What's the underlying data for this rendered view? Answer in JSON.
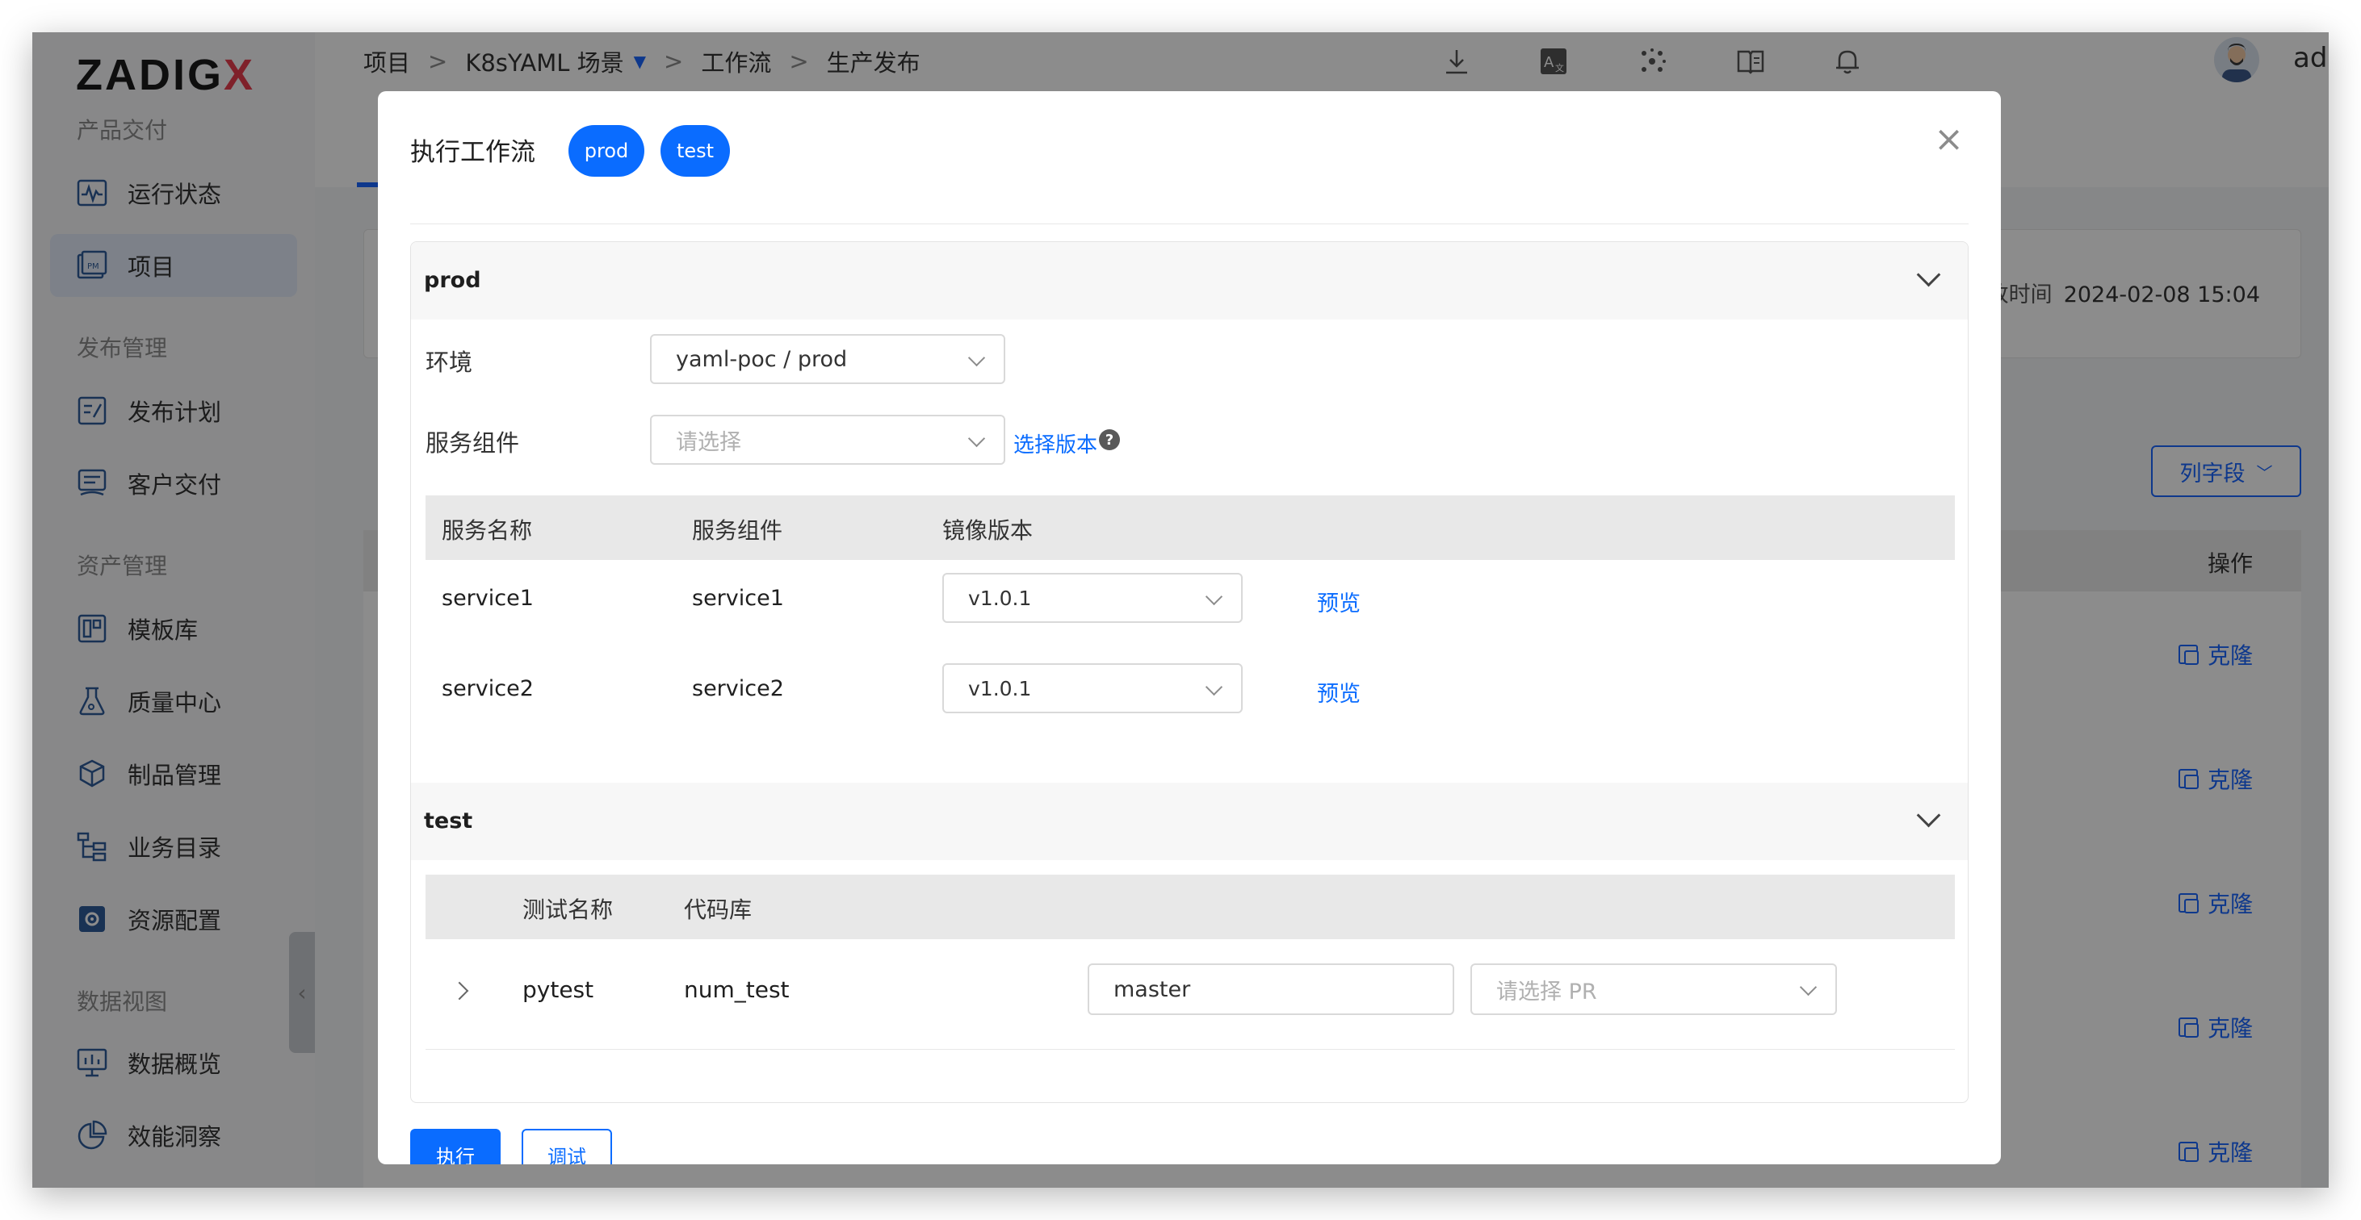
{
  "brand": {
    "logo_main": "ZADIG",
    "logo_x": "X",
    "accent": "#0a6cff",
    "logo_accent": "#e73c4e"
  },
  "sidebar": {
    "groups": [
      "产品交付",
      "发布管理",
      "资产管理",
      "数据视图"
    ],
    "items": [
      {
        "label": "运行状态",
        "icon": "pulse-chart-icon"
      },
      {
        "label": "项目",
        "icon": "project-pm-icon",
        "active": true
      },
      {
        "label": "发布计划",
        "icon": "release-plan-icon"
      },
      {
        "label": "客户交付",
        "icon": "customer-delivery-icon"
      },
      {
        "label": "模板库",
        "icon": "template-icon"
      },
      {
        "label": "质量中心",
        "icon": "flask-icon"
      },
      {
        "label": "制品管理",
        "icon": "artifact-icon"
      },
      {
        "label": "业务目录",
        "icon": "catalog-tree-icon"
      },
      {
        "label": "资源配置",
        "icon": "gear-icon"
      },
      {
        "label": "数据概览",
        "icon": "monitor-chart-icon"
      },
      {
        "label": "效能洞察",
        "icon": "pie-chart-icon"
      }
    ],
    "collapse_glyph": "‹"
  },
  "topbar": {
    "breadcrumb": [
      "项目",
      "K8sYAML 场景",
      "工作流",
      "生产发布"
    ],
    "separator": ">",
    "icons": [
      "download-icon",
      "translate-icon",
      "plugin-icon",
      "docs-icon",
      "bell-icon"
    ],
    "user": "admin(admin)",
    "more": "⋮"
  },
  "background_page": {
    "modified_label": "修改时间",
    "modified_value": "2024-02-08 15:04",
    "column_field_button": "列字段",
    "operations_header": "操作",
    "clone_label": "克隆",
    "row_count": 5
  },
  "dialog": {
    "title": "执行工作流",
    "chips": [
      "prod",
      "test"
    ],
    "close": "×",
    "prod": {
      "title": "prod",
      "env_label": "环境",
      "env_value": "yaml-poc / prod",
      "service_label": "服务组件",
      "service_placeholder": "请选择",
      "select_version_link": "选择版本",
      "help": "?",
      "columns": [
        "服务名称",
        "服务组件",
        "镜像版本"
      ],
      "rows": [
        {
          "name": "service1",
          "component": "service1",
          "version": "v1.0.1",
          "action": "预览"
        },
        {
          "name": "service2",
          "component": "service2",
          "version": "v1.0.1",
          "action": "预览"
        }
      ]
    },
    "test": {
      "title": "test",
      "columns": [
        "测试名称",
        "代码库"
      ],
      "rows": [
        {
          "name": "pytest",
          "repo": "num_test",
          "branch": "master",
          "pr_placeholder": "请选择 PR"
        }
      ]
    },
    "run_button": "执行",
    "debug_button": "调试"
  }
}
